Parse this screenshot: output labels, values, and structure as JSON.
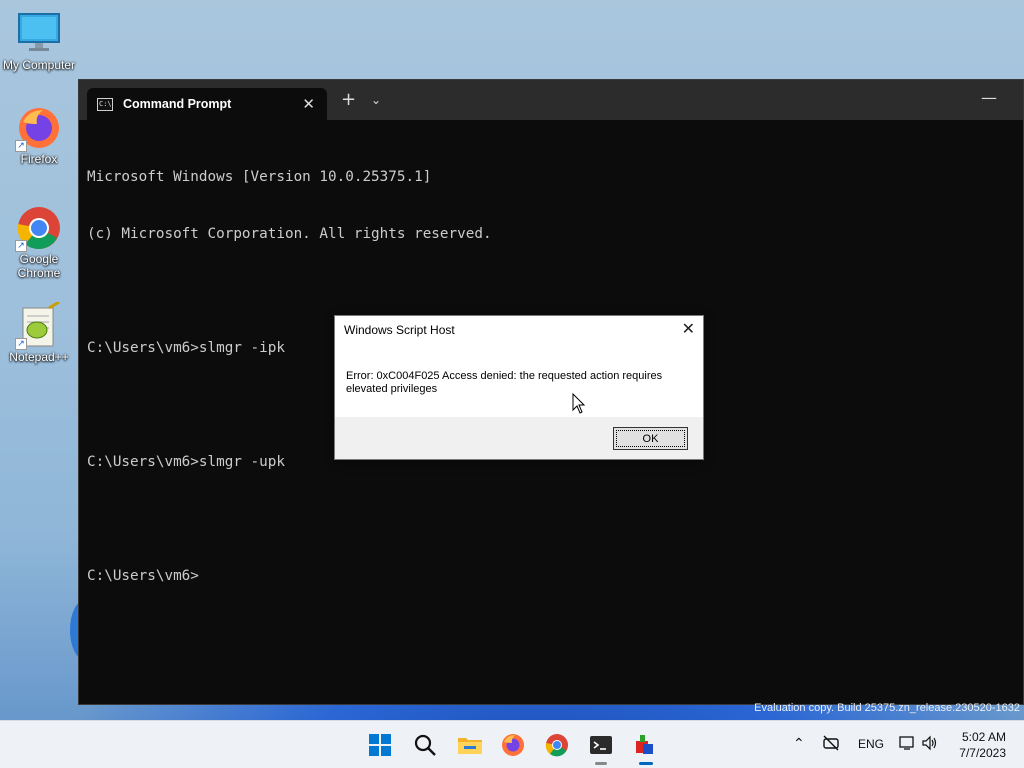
{
  "desktop": {
    "icons": [
      {
        "label": "My Computer"
      },
      {
        "label": "Firefox"
      },
      {
        "label": "Google Chrome"
      },
      {
        "label": "Notepad++"
      }
    ],
    "watermark": "Evaluation copy. Build 25375.zn_release.230520-1632"
  },
  "terminal": {
    "tab_title": "Command Prompt",
    "lines": [
      "Microsoft Windows [Version 10.0.25375.1]",
      "(c) Microsoft Corporation. All rights reserved.",
      "",
      "C:\\Users\\vm6>slmgr -ipk",
      "",
      "C:\\Users\\vm6>slmgr -upk",
      "",
      "C:\\Users\\vm6>"
    ]
  },
  "dialog": {
    "title": "Windows Script Host",
    "message": "Error: 0xC004F025 Access denied: the requested action requires elevated privileges",
    "ok_label": "OK"
  },
  "taskbar": {
    "language": "ENG",
    "time": "5:02 AM",
    "date": "7/7/2023"
  },
  "colors": {
    "terminal_bg": "#0c0c0c",
    "terminal_text": "#cccccc",
    "taskbar_bg": "#eef1f6",
    "accent": "#0067c0"
  }
}
